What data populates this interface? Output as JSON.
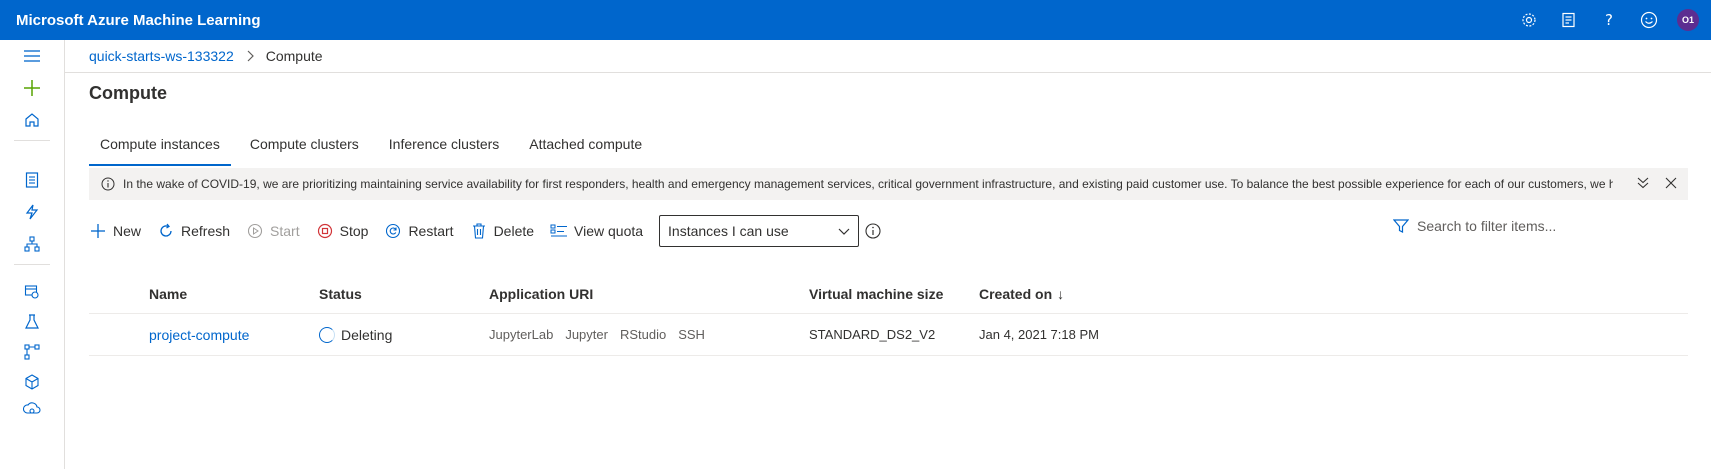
{
  "header": {
    "title": "Microsoft Azure Machine Learning",
    "avatar_initials": "O1"
  },
  "breadcrumb": {
    "workspace": "quick-starts-ws-133322",
    "current": "Compute"
  },
  "page": {
    "title": "Compute"
  },
  "tabs": [
    {
      "label": "Compute instances",
      "active": true
    },
    {
      "label": "Compute clusters",
      "active": false
    },
    {
      "label": "Inference clusters",
      "active": false
    },
    {
      "label": "Attached compute",
      "active": false
    }
  ],
  "banner": {
    "text": "In the wake of COVID-19, we are prioritizing maintaining service availability for first responders, health and emergency management services, critical government infrastructure, and existing paid customer use. To balance the best possible experience for each of our customers, we h..."
  },
  "toolbar": {
    "new": "New",
    "refresh": "Refresh",
    "start": "Start",
    "stop": "Stop",
    "restart": "Restart",
    "delete": "Delete",
    "view_quota": "View quota",
    "filter_selected": "Instances I can use",
    "search_placeholder": "Search to filter items..."
  },
  "table": {
    "columns": [
      "Name",
      "Status",
      "Application URI",
      "Virtual machine size",
      "Created on"
    ],
    "sort_indicator": "↓",
    "rows": [
      {
        "name": "project-compute",
        "status": "Deleting",
        "uris": [
          "JupyterLab",
          "Jupyter",
          "RStudio",
          "SSH"
        ],
        "vm_size": "STANDARD_DS2_V2",
        "created": "Jan 4, 2021 7:18 PM"
      }
    ]
  },
  "colors": {
    "brand": "#0066cc",
    "new_plus": "#57a300",
    "stop": "#d13438"
  }
}
